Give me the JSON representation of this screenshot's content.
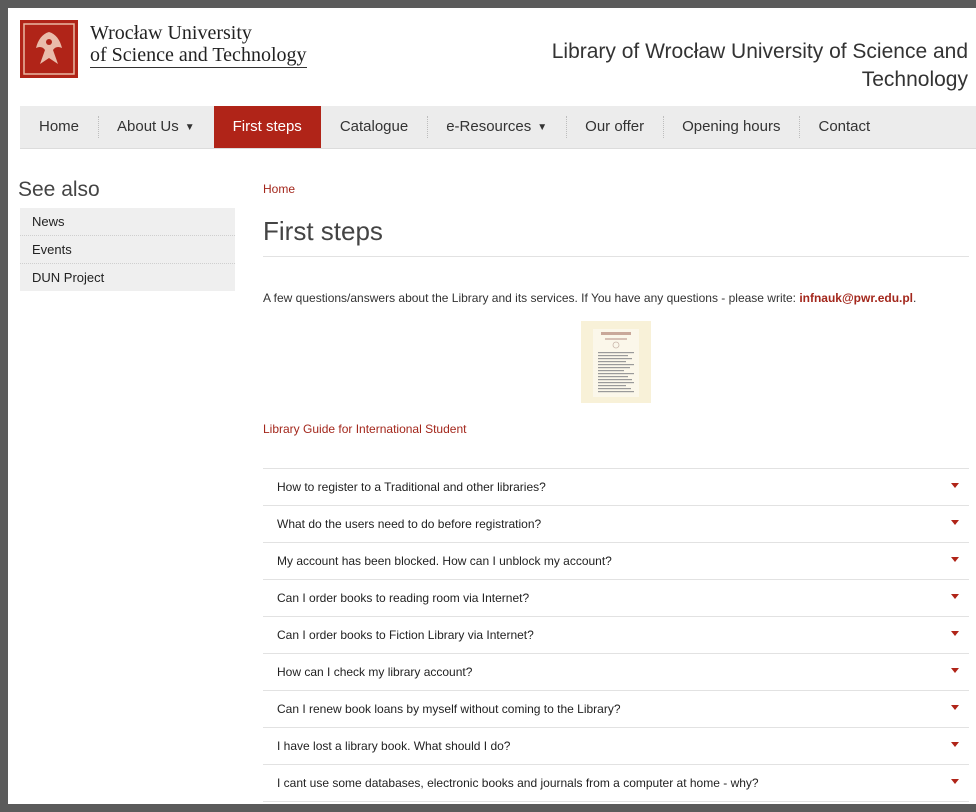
{
  "header": {
    "uni_line1": "Wrocław University",
    "uni_line2": "of Science and Technology",
    "library_title": "Library of Wrocław University of Science and Technology"
  },
  "nav": {
    "items": [
      {
        "label": "Home",
        "dropdown": false
      },
      {
        "label": "About Us",
        "dropdown": true
      },
      {
        "label": "First steps",
        "dropdown": false,
        "active": true
      },
      {
        "label": "Catalogue",
        "dropdown": false
      },
      {
        "label": "e-Resources",
        "dropdown": true
      },
      {
        "label": "Our offer",
        "dropdown": false
      },
      {
        "label": "Opening hours",
        "dropdown": false
      },
      {
        "label": "Contact",
        "dropdown": false
      }
    ],
    "caret": "▼"
  },
  "sidebar": {
    "heading": "See also",
    "items": [
      "News",
      "Events",
      "DUN Project"
    ]
  },
  "main": {
    "breadcrumb": "Home",
    "title": "First steps",
    "intro_text": "A few questions/answers about the Library and its services. If You have any questions - please write: ",
    "intro_email": "infnauk@pwr.edu.pl",
    "intro_end": ".",
    "guide_link": "Library Guide for International Student",
    "faq": [
      "How to register to a Traditional and other libraries?",
      "What do the users need to do before registration?",
      "My account has been blocked. How can I unblock my account?",
      "Can I order books to reading room via Internet?",
      "Can I order books to Fiction Library via Internet?",
      "How can I check my library account?",
      "Can I renew book loans by myself without coming to the Library?",
      "I have lost a library book. What should I do?",
      "I cant use some databases, electronic books and journals from a computer at home - why?"
    ]
  },
  "colors": {
    "brand_red": "#b02418",
    "link_red": "#a3271c",
    "nav_bg": "#ececec"
  }
}
